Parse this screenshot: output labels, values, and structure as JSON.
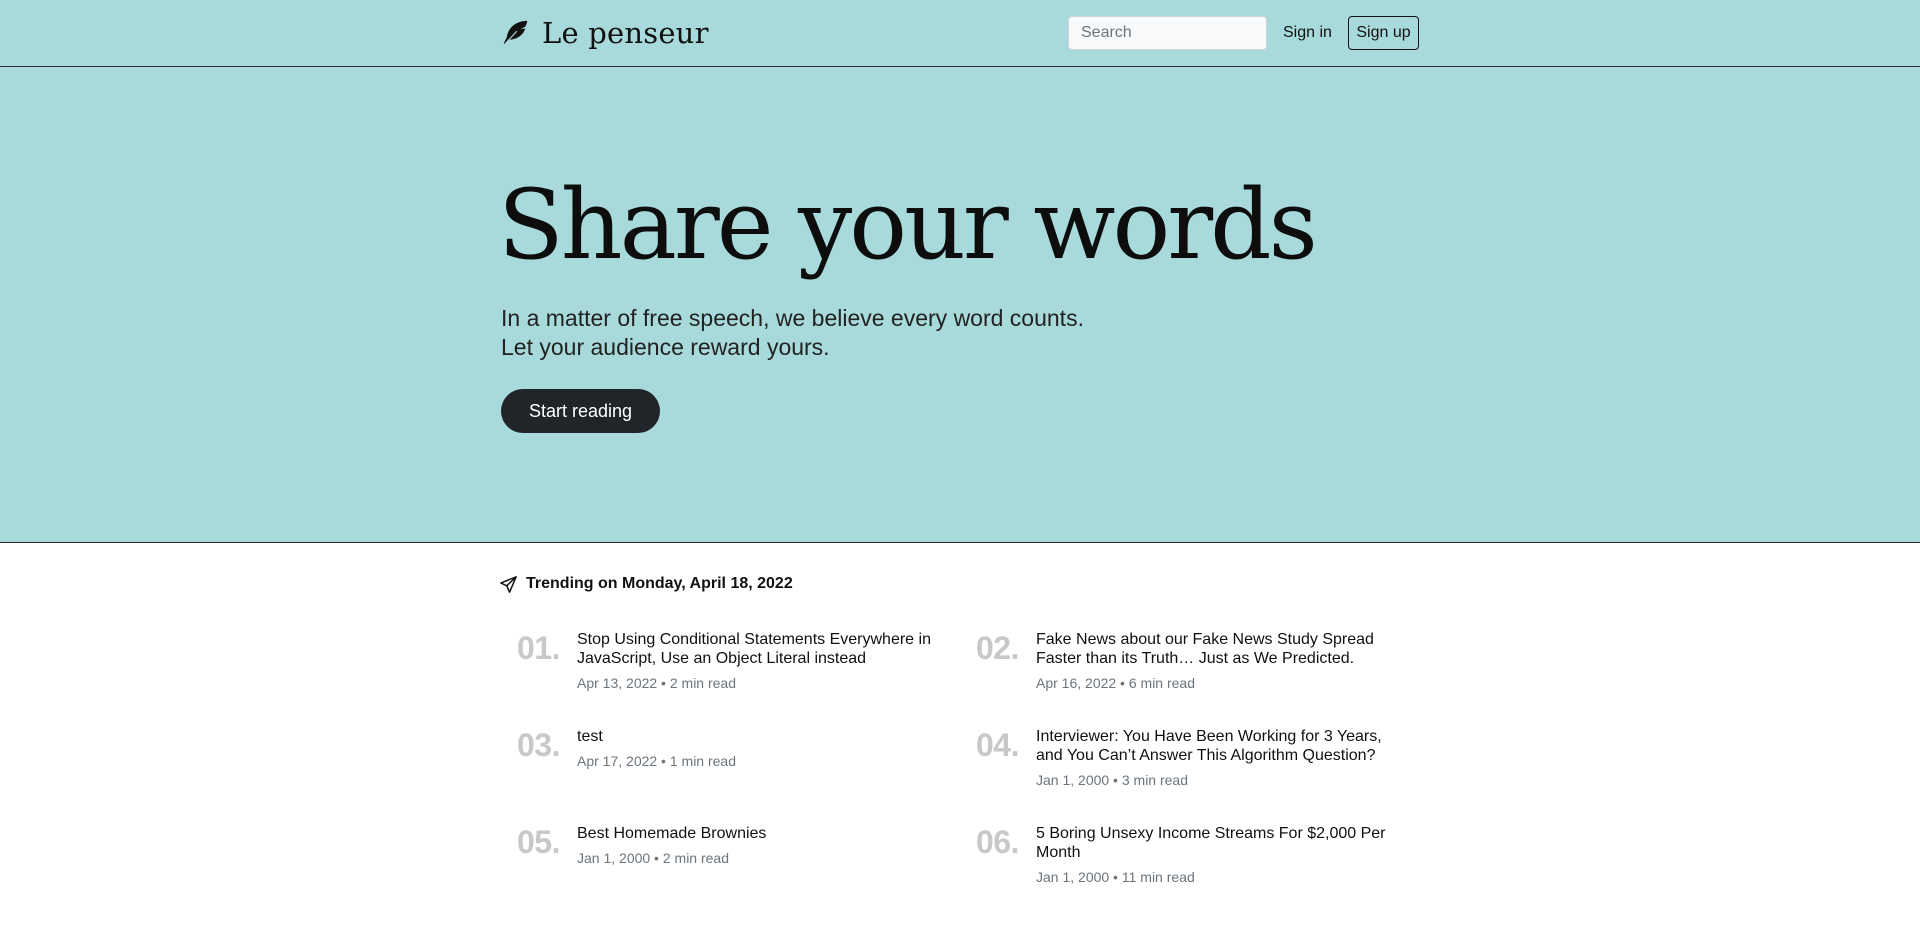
{
  "brand": {
    "name": "Le penseur",
    "icon": "feather-icon"
  },
  "nav": {
    "search_placeholder": "Search",
    "signin_label": "Sign in",
    "signup_label": "Sign up"
  },
  "hero": {
    "title": "Share your words",
    "subtitle_line1": "In a matter of free speech, we believe every word counts.",
    "subtitle_line2": "Let your audience reward yours.",
    "cta_label": "Start reading"
  },
  "trending": {
    "icon": "paper-plane-icon",
    "heading": "Trending on Monday, April 18, 2022",
    "items": [
      {
        "num": "01.",
        "title": "Stop Using Conditional Statements Everywhere in JavaScript, Use an Object Literal instead",
        "meta": "Apr 13, 2022 • 2 min read"
      },
      {
        "num": "02.",
        "title": "Fake News about our Fake News Study Spread Faster than its Truth… Just as We Predicted.",
        "meta": "Apr 16, 2022 • 6 min read"
      },
      {
        "num": "03.",
        "title": "test",
        "meta": "Apr 17, 2022 • 1 min read"
      },
      {
        "num": "04.",
        "title": "Interviewer: You Have Been Working for 3 Years, and You Can’t Answer This Algorithm Question?",
        "meta": "Jan 1, 2000 • 3 min read"
      },
      {
        "num": "05.",
        "title": "Best Homemade Brownies",
        "meta": "Jan 1, 2000 • 2 min read"
      },
      {
        "num": "06.",
        "title": "5 Boring Unsexy Income Streams For $2,000 Per Month",
        "meta": "Jan 1, 2000 • 11 min read"
      }
    ]
  },
  "colors": {
    "accent_background": "#a8dadb",
    "cta_background": "#212529",
    "rank_number": "#c8c8c8",
    "meta_text": "#6c757d"
  }
}
